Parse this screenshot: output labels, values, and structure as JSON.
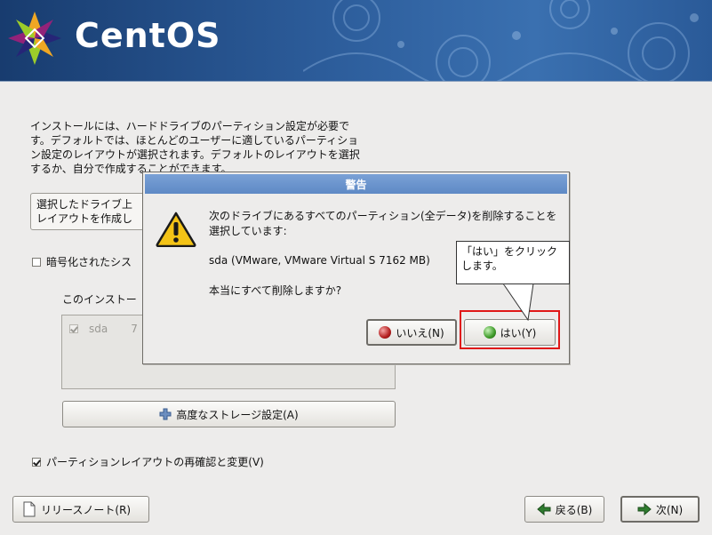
{
  "header": {
    "logo_text": "CentOS"
  },
  "main": {
    "intro_text": "インストールには、ハードドライブのパーティション設定が必要です。デフォルトでは、ほとんどのユーザーに適しているパーティション設定のレイアウトが選択されます。デフォルトのレイアウトを選択するか、自分で作成することができます。",
    "layout_select_text": "選択したドライブ上\nレイアウトを作成し",
    "encrypt_label": "暗号化されたシス",
    "drive_list_label": "このインストー",
    "drive_row": {
      "name": "sda",
      "size": "7"
    },
    "advanced_button": "高度なストレージ設定(A)",
    "review_label": "パーティションレイアウトの再確認と変更(V)"
  },
  "footer": {
    "release_notes": "リリースノート(R)",
    "back": "戻る(B)",
    "next": "次(N)"
  },
  "dialog": {
    "title": "警告",
    "message": "次のドライブにあるすべてのパーティション(全データ)を削除することを選択しています:",
    "drive": "sda (VMware, VMware Virtual S 7162 MB)",
    "confirm": "本当にすべて削除しますか?",
    "no_button": "いいえ(N)",
    "yes_button": "はい(Y)"
  },
  "annotation": {
    "callout": "「はい」をクリックします。",
    "highlight_color": "#e01818"
  },
  "colors": {
    "banner": "#2c5c9a",
    "dialog_title": "#6b93cc"
  }
}
